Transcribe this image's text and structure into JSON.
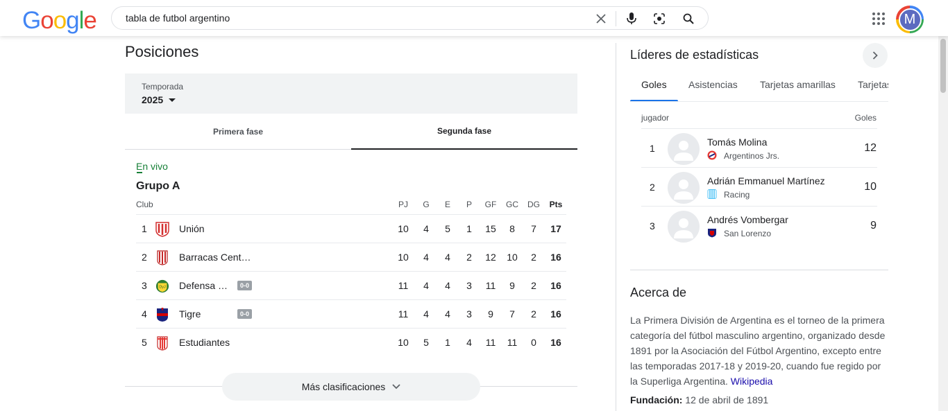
{
  "header": {
    "logo": {
      "letters": [
        "G",
        "o",
        "o",
        "g",
        "l",
        "e"
      ],
      "colors": [
        "#4285f4",
        "#ea4335",
        "#fbbc05",
        "#4285f4",
        "#34a853",
        "#ea4335"
      ]
    },
    "search_query": "tabla de futbol argentino",
    "avatar_letter": "M"
  },
  "standings": {
    "title": "Posiciones",
    "season_label": "Temporada",
    "season_value": "2025",
    "phase_tabs": [
      {
        "label": "Primera fase",
        "active": false
      },
      {
        "label": "Segunda fase",
        "active": true
      }
    ],
    "live_label": "En vivo",
    "group_title": "Grupo A",
    "columns": {
      "club": "Club",
      "stats": [
        "PJ",
        "G",
        "E",
        "P",
        "GF",
        "GC",
        "DG",
        "Pts"
      ]
    },
    "rows": [
      {
        "pos": "1",
        "club": "Unión",
        "badge": "",
        "stats": [
          "10",
          "4",
          "5",
          "1",
          "15",
          "8",
          "7",
          "17"
        ],
        "crest": "union-crest-icon"
      },
      {
        "pos": "2",
        "club": "Barracas Central",
        "badge": "",
        "stats": [
          "10",
          "4",
          "4",
          "2",
          "12",
          "10",
          "2",
          "16"
        ],
        "crest": "barracas-crest-icon"
      },
      {
        "pos": "3",
        "club": "Defensa y Justicia",
        "badge": "0-0",
        "stats": [
          "11",
          "4",
          "4",
          "3",
          "11",
          "9",
          "2",
          "16"
        ],
        "crest": "defensa-crest-icon"
      },
      {
        "pos": "4",
        "club": "Tigre",
        "badge": "0-0",
        "stats": [
          "11",
          "4",
          "4",
          "3",
          "9",
          "7",
          "2",
          "16"
        ],
        "crest": "tigre-crest-icon"
      },
      {
        "pos": "5",
        "club": "Estudiantes",
        "badge": "",
        "stats": [
          "10",
          "5",
          "1",
          "4",
          "11",
          "11",
          "0",
          "16"
        ],
        "crest": "estudiantes-crest-icon"
      }
    ],
    "more_label": "Más clasificaciones"
  },
  "leaders": {
    "title": "Líderes de estadísticas",
    "tabs": [
      "Goles",
      "Asistencias",
      "Tarjetas amarillas",
      "Tarjetas rojas"
    ],
    "active_tab": "Goles",
    "col_player": "jugador",
    "col_stat": "Goles",
    "rows": [
      {
        "pos": "1",
        "name": "Tomás Molina",
        "team": "Argentinos Jrs.",
        "value": "12"
      },
      {
        "pos": "2",
        "name": "Adrián Emmanuel Martínez",
        "team": "Racing",
        "value": "10"
      },
      {
        "pos": "3",
        "name": "Andrés Vombergar",
        "team": "San Lorenzo",
        "value": "9"
      }
    ]
  },
  "about": {
    "title": "Acerca de",
    "text": "La Primera División de Argentina es el torneo de la primera categoría del fútbol masculino argentino, organizado desde 1891 por la Asociación del Fútbol Argentino, excepto entre las temporadas 2017-18 y 2019-20, cuando fue regido por la Superliga Argentina.",
    "source_link": "Wikipedia",
    "founded_label": "Fundación:",
    "founded_value": "12 de abril de 1891"
  }
}
